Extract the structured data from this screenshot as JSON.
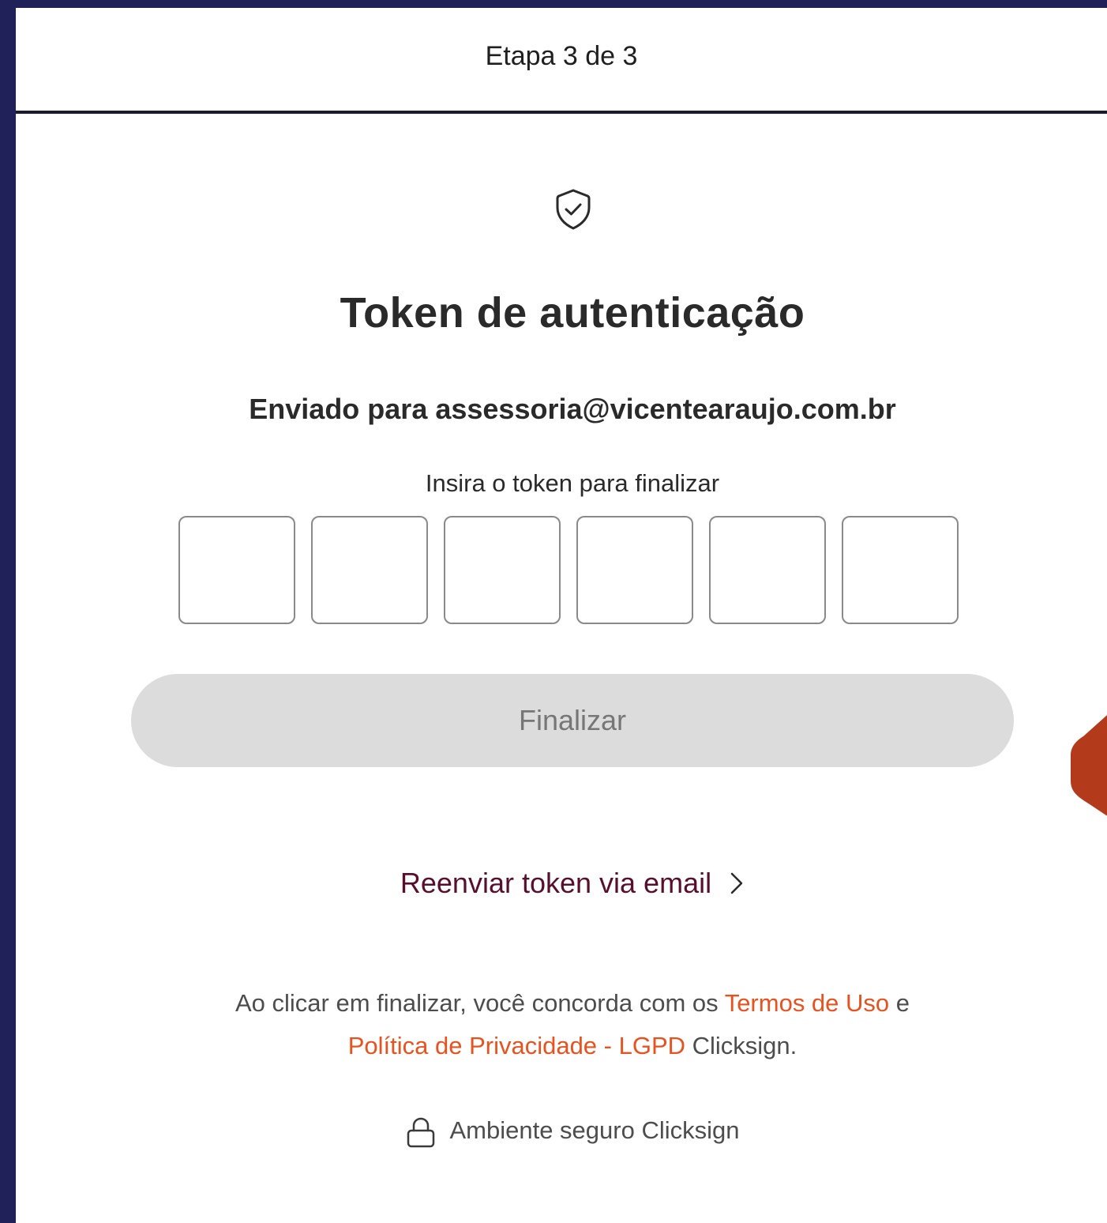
{
  "header": {
    "step_label": "Etapa 3 de 3"
  },
  "icons": {
    "shield": "shield-check-icon",
    "chevron": "chevron-right-icon",
    "lock": "lock-icon"
  },
  "main": {
    "title": "Token de autenticação",
    "sent_to": "Enviado para assessoria@vicentearaujo.com.br",
    "instruction": "Insira o token para finalizar",
    "token_digits": [
      "",
      "",
      "",
      "",
      "",
      ""
    ],
    "finalize_label": "Finalizar",
    "resend_label": "Reenviar token via email"
  },
  "legal": {
    "prefix": "Ao clicar em finalizar, você concorda com os ",
    "terms_link": "Termos de Uso",
    "connector": " e",
    "privacy_link": "Política de Privacidade - LGPD",
    "suffix": " Clicksign."
  },
  "footer": {
    "secure_label": "Ambiente seguro Clicksign"
  },
  "colors": {
    "page_background": "#21215a",
    "link_orange": "#e8521e",
    "resend_link": "#5a0e2e",
    "button_disabled": "#dcdcdc",
    "orange_shape": "#b33a1a"
  }
}
